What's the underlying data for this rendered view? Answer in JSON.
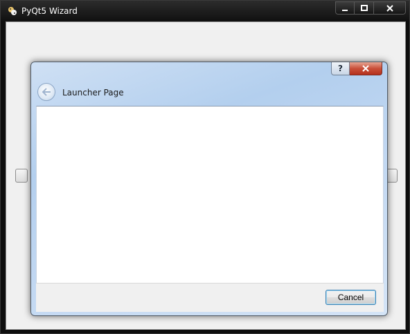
{
  "main_window": {
    "title": "PyQt5 Wizard",
    "caption_buttons": [
      "minimize",
      "maximize",
      "close"
    ]
  },
  "dialog": {
    "page_title": "Launcher Page",
    "help_label": "?",
    "cancel_label": "Cancel"
  },
  "colors": {
    "dialog_frame_blue": "#b3cfee",
    "close_red": "#c9503a",
    "cancel_focus_border": "#3c7fb1"
  }
}
